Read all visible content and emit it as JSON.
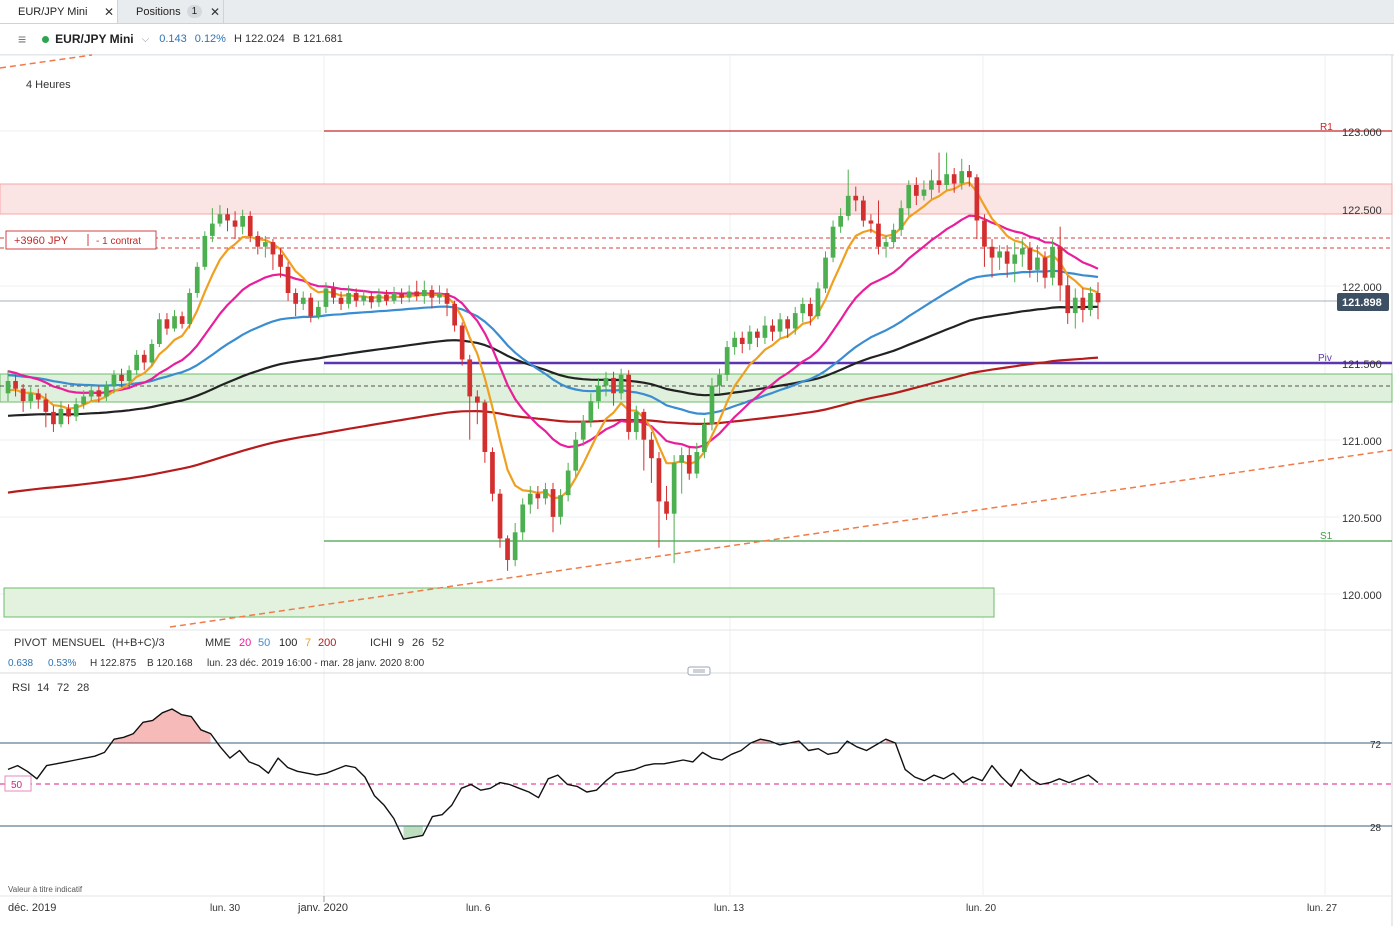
{
  "tabs": [
    {
      "label": "EUR/JPY Mini",
      "close": "✕"
    },
    {
      "label": "Positions",
      "badge": "1",
      "close": "✕"
    }
  ],
  "instrument": {
    "menu_icon": "hamburger-icon",
    "status_color": "#2ea44f",
    "name": "EUR/JPY Mini",
    "change": "0.143",
    "change_pct": "0.12%",
    "high": "H 122.024",
    "low": "B 121.681"
  },
  "timeframe": "4 Heures",
  "position_tag": {
    "pnl": "+3960 JPY",
    "size": "- 1 contrat"
  },
  "price_axis": {
    "ticks": [
      "123.000",
      "122.500",
      "122.000",
      "121.500",
      "121.000",
      "120.500",
      "120.000"
    ],
    "current_price": "121.898"
  },
  "levels": {
    "r1": "R1",
    "piv": "Piv",
    "s1": "S1"
  },
  "indicator_legend": {
    "pivot_name": "PIVOT",
    "pivot_period": "MENSUEL",
    "pivot_formula": "(H+B+C)/3",
    "mme_name": "MME",
    "mme_periods": [
      "20",
      "50",
      "100",
      "7",
      "200"
    ],
    "ichi_name": "ICHI",
    "ichi_params": [
      "9",
      "26",
      "52"
    ],
    "stats": {
      "change": "0.638",
      "change_pct": "0.53%",
      "high": "H 122.875",
      "low": "B 120.168",
      "range": "lun. 23 déc. 2019 16:00 - mar. 28 janv. 2020 8:00"
    }
  },
  "rsi": {
    "label": "RSI",
    "params": [
      "14",
      "72",
      "28"
    ],
    "levels": [
      "72",
      "50",
      "28"
    ]
  },
  "disclaimer": "Valeur à titre indicatif",
  "time_axis": [
    "déc. 2019",
    "lun. 30",
    "janv. 2020",
    "lun. 6",
    "lun. 13",
    "lun. 20",
    "lun. 27"
  ],
  "colors": {
    "up": "#4caf50",
    "down": "#d32f2f",
    "ema20": "#e91e9c",
    "ema50": "#3a8dd1",
    "ema100": "#222222",
    "ema7": "#f0a020",
    "ema200": "#b71c1c",
    "pivot": "#5e35b1",
    "trendline": "#f07b47",
    "rsi_line": "#111111"
  },
  "chart_data": {
    "type": "candlestick",
    "price_range": [
      119.8,
      123.4
    ],
    "rsi_range": [
      0,
      100
    ],
    "pivot_levels": {
      "R1": 123.0,
      "Piv": 121.5,
      "S1": 120.34
    },
    "candles": [
      {
        "o": 121.3,
        "c": 121.38,
        "h": 121.45,
        "l": 121.25
      },
      {
        "o": 121.38,
        "c": 121.33,
        "h": 121.42,
        "l": 121.28
      },
      {
        "o": 121.33,
        "c": 121.25,
        "h": 121.36,
        "l": 121.18
      },
      {
        "o": 121.25,
        "c": 121.3,
        "h": 121.34,
        "l": 121.2
      },
      {
        "o": 121.3,
        "c": 121.26,
        "h": 121.33,
        "l": 121.2
      },
      {
        "o": 121.26,
        "c": 121.18,
        "h": 121.3,
        "l": 121.08
      },
      {
        "o": 121.18,
        "c": 121.1,
        "h": 121.22,
        "l": 121.05
      },
      {
        "o": 121.1,
        "c": 121.2,
        "h": 121.25,
        "l": 121.08
      },
      {
        "o": 121.2,
        "c": 121.15,
        "h": 121.23,
        "l": 121.1
      },
      {
        "o": 121.15,
        "c": 121.23,
        "h": 121.27,
        "l": 121.12
      },
      {
        "o": 121.23,
        "c": 121.28,
        "h": 121.32,
        "l": 121.2
      },
      {
        "o": 121.28,
        "c": 121.32,
        "h": 121.36,
        "l": 121.25
      },
      {
        "o": 121.32,
        "c": 121.28,
        "h": 121.35,
        "l": 121.24
      },
      {
        "o": 121.28,
        "c": 121.35,
        "h": 121.38,
        "l": 121.25
      },
      {
        "o": 121.35,
        "c": 121.42,
        "h": 121.45,
        "l": 121.3
      },
      {
        "o": 121.42,
        "c": 121.38,
        "h": 121.46,
        "l": 121.34
      },
      {
        "o": 121.38,
        "c": 121.45,
        "h": 121.48,
        "l": 121.35
      },
      {
        "o": 121.45,
        "c": 121.55,
        "h": 121.58,
        "l": 121.42
      },
      {
        "o": 121.55,
        "c": 121.5,
        "h": 121.58,
        "l": 121.45
      },
      {
        "o": 121.5,
        "c": 121.62,
        "h": 121.65,
        "l": 121.48
      },
      {
        "o": 121.62,
        "c": 121.78,
        "h": 121.82,
        "l": 121.6
      },
      {
        "o": 121.78,
        "c": 121.72,
        "h": 121.82,
        "l": 121.68
      },
      {
        "o": 121.72,
        "c": 121.8,
        "h": 121.84,
        "l": 121.7
      },
      {
        "o": 121.8,
        "c": 121.75,
        "h": 121.83,
        "l": 121.72
      },
      {
        "o": 121.75,
        "c": 121.95,
        "h": 121.98,
        "l": 121.72
      },
      {
        "o": 121.95,
        "c": 122.12,
        "h": 122.15,
        "l": 121.92
      },
      {
        "o": 122.12,
        "c": 122.32,
        "h": 122.35,
        "l": 122.1
      },
      {
        "o": 122.32,
        "c": 122.4,
        "h": 122.5,
        "l": 122.28
      },
      {
        "o": 122.4,
        "c": 122.46,
        "h": 122.52,
        "l": 122.38
      },
      {
        "o": 122.46,
        "c": 122.42,
        "h": 122.5,
        "l": 122.35
      },
      {
        "o": 122.42,
        "c": 122.38,
        "h": 122.48,
        "l": 122.3
      },
      {
        "o": 122.38,
        "c": 122.45,
        "h": 122.49,
        "l": 122.33
      },
      {
        "o": 122.45,
        "c": 122.32,
        "h": 122.48,
        "l": 122.28
      },
      {
        "o": 122.32,
        "c": 122.25,
        "h": 122.35,
        "l": 122.2
      },
      {
        "o": 122.25,
        "c": 122.28,
        "h": 122.32,
        "l": 122.18
      },
      {
        "o": 122.28,
        "c": 122.2,
        "h": 122.3,
        "l": 122.1
      },
      {
        "o": 122.2,
        "c": 122.12,
        "h": 122.24,
        "l": 122.05
      },
      {
        "o": 122.12,
        "c": 121.95,
        "h": 122.15,
        "l": 121.9
      },
      {
        "o": 121.95,
        "c": 121.88,
        "h": 121.98,
        "l": 121.8
      },
      {
        "o": 121.88,
        "c": 121.92,
        "h": 121.96,
        "l": 121.84
      },
      {
        "o": 121.92,
        "c": 121.8,
        "h": 121.95,
        "l": 121.76
      },
      {
        "o": 121.8,
        "c": 121.86,
        "h": 121.9,
        "l": 121.78
      },
      {
        "o": 121.86,
        "c": 121.98,
        "h": 122.02,
        "l": 121.82
      },
      {
        "o": 121.98,
        "c": 121.92,
        "h": 122.02,
        "l": 121.88
      },
      {
        "o": 121.92,
        "c": 121.88,
        "h": 121.96,
        "l": 121.84
      },
      {
        "o": 121.88,
        "c": 121.95,
        "h": 122.0,
        "l": 121.85
      },
      {
        "o": 121.95,
        "c": 121.9,
        "h": 121.98,
        "l": 121.86
      },
      {
        "o": 121.9,
        "c": 121.93,
        "h": 121.97,
        "l": 121.87
      },
      {
        "o": 121.93,
        "c": 121.89,
        "h": 121.96,
        "l": 121.85
      },
      {
        "o": 121.89,
        "c": 121.94,
        "h": 121.98,
        "l": 121.86
      },
      {
        "o": 121.94,
        "c": 121.9,
        "h": 121.97,
        "l": 121.87
      },
      {
        "o": 121.9,
        "c": 121.95,
        "h": 121.99,
        "l": 121.88
      },
      {
        "o": 121.95,
        "c": 121.92,
        "h": 121.98,
        "l": 121.88
      },
      {
        "o": 121.92,
        "c": 121.96,
        "h": 122.0,
        "l": 121.89
      },
      {
        "o": 121.96,
        "c": 121.93,
        "h": 122.03,
        "l": 121.9
      },
      {
        "o": 121.93,
        "c": 121.97,
        "h": 122.03,
        "l": 121.88
      },
      {
        "o": 121.97,
        "c": 121.92,
        "h": 122.0,
        "l": 121.85
      },
      {
        "o": 121.92,
        "c": 121.95,
        "h": 122.0,
        "l": 121.88
      },
      {
        "o": 121.95,
        "c": 121.88,
        "h": 121.98,
        "l": 121.8
      },
      {
        "o": 121.88,
        "c": 121.74,
        "h": 121.9,
        "l": 121.7
      },
      {
        "o": 121.74,
        "c": 121.52,
        "h": 121.76,
        "l": 121.48
      },
      {
        "o": 121.52,
        "c": 121.28,
        "h": 121.55,
        "l": 121.0
      },
      {
        "o": 121.28,
        "c": 121.24,
        "h": 121.32,
        "l": 121.1
      },
      {
        "o": 121.24,
        "c": 120.92,
        "h": 121.26,
        "l": 120.85
      },
      {
        "o": 120.92,
        "c": 120.65,
        "h": 120.95,
        "l": 120.6
      },
      {
        "o": 120.65,
        "c": 120.36,
        "h": 120.68,
        "l": 120.3
      },
      {
        "o": 120.36,
        "c": 120.22,
        "h": 120.38,
        "l": 120.15
      },
      {
        "o": 120.22,
        "c": 120.4,
        "h": 120.46,
        "l": 120.18
      },
      {
        "o": 120.4,
        "c": 120.58,
        "h": 120.62,
        "l": 120.35
      },
      {
        "o": 120.58,
        "c": 120.65,
        "h": 120.7,
        "l": 120.52
      },
      {
        "o": 120.65,
        "c": 120.62,
        "h": 120.7,
        "l": 120.55
      },
      {
        "o": 120.62,
        "c": 120.68,
        "h": 120.72,
        "l": 120.58
      },
      {
        "o": 120.68,
        "c": 120.5,
        "h": 120.72,
        "l": 120.4
      },
      {
        "o": 120.5,
        "c": 120.64,
        "h": 120.68,
        "l": 120.45
      },
      {
        "o": 120.64,
        "c": 120.8,
        "h": 120.85,
        "l": 120.6
      },
      {
        "o": 120.8,
        "c": 121.0,
        "h": 121.05,
        "l": 120.76
      },
      {
        "o": 121.0,
        "c": 121.12,
        "h": 121.16,
        "l": 120.96
      },
      {
        "o": 121.12,
        "c": 121.25,
        "h": 121.3,
        "l": 121.08
      },
      {
        "o": 121.25,
        "c": 121.35,
        "h": 121.4,
        "l": 121.2
      },
      {
        "o": 121.35,
        "c": 121.4,
        "h": 121.44,
        "l": 121.28
      },
      {
        "o": 121.4,
        "c": 121.3,
        "h": 121.44,
        "l": 121.22
      },
      {
        "o": 121.3,
        "c": 121.42,
        "h": 121.46,
        "l": 121.26
      },
      {
        "o": 121.42,
        "c": 121.05,
        "h": 121.45,
        "l": 121.0
      },
      {
        "o": 121.05,
        "c": 121.18,
        "h": 121.22,
        "l": 121.0
      },
      {
        "o": 121.18,
        "c": 121.0,
        "h": 121.2,
        "l": 120.8
      },
      {
        "o": 121.0,
        "c": 120.88,
        "h": 121.05,
        "l": 120.72
      },
      {
        "o": 120.88,
        "c": 120.6,
        "h": 120.92,
        "l": 120.3
      },
      {
        "o": 120.6,
        "c": 120.52,
        "h": 120.7,
        "l": 120.48
      },
      {
        "o": 120.52,
        "c": 120.85,
        "h": 120.9,
        "l": 120.2
      },
      {
        "o": 120.85,
        "c": 120.9,
        "h": 120.95,
        "l": 120.65
      },
      {
        "o": 120.9,
        "c": 120.78,
        "h": 120.96,
        "l": 120.74
      },
      {
        "o": 120.78,
        "c": 120.92,
        "h": 120.98,
        "l": 120.75
      },
      {
        "o": 120.92,
        "c": 121.1,
        "h": 121.14,
        "l": 120.88
      },
      {
        "o": 121.1,
        "c": 121.35,
        "h": 121.4,
        "l": 121.06
      },
      {
        "o": 121.35,
        "c": 121.42,
        "h": 121.46,
        "l": 121.3
      },
      {
        "o": 121.42,
        "c": 121.6,
        "h": 121.64,
        "l": 121.38
      },
      {
        "o": 121.6,
        "c": 121.66,
        "h": 121.7,
        "l": 121.55
      },
      {
        "o": 121.66,
        "c": 121.62,
        "h": 121.7,
        "l": 121.56
      },
      {
        "o": 121.62,
        "c": 121.7,
        "h": 121.74,
        "l": 121.58
      },
      {
        "o": 121.7,
        "c": 121.66,
        "h": 121.72,
        "l": 121.6
      },
      {
        "o": 121.66,
        "c": 121.74,
        "h": 121.8,
        "l": 121.62
      },
      {
        "o": 121.74,
        "c": 121.7,
        "h": 121.78,
        "l": 121.64
      },
      {
        "o": 121.7,
        "c": 121.78,
        "h": 121.82,
        "l": 121.66
      },
      {
        "o": 121.78,
        "c": 121.72,
        "h": 121.8,
        "l": 121.66
      },
      {
        "o": 121.72,
        "c": 121.82,
        "h": 121.86,
        "l": 121.68
      },
      {
        "o": 121.82,
        "c": 121.88,
        "h": 121.92,
        "l": 121.76
      },
      {
        "o": 121.88,
        "c": 121.8,
        "h": 121.92,
        "l": 121.74
      },
      {
        "o": 121.8,
        "c": 121.98,
        "h": 122.02,
        "l": 121.78
      },
      {
        "o": 121.98,
        "c": 122.18,
        "h": 122.22,
        "l": 121.95
      },
      {
        "o": 122.18,
        "c": 122.38,
        "h": 122.42,
        "l": 122.15
      },
      {
        "o": 122.38,
        "c": 122.45,
        "h": 122.5,
        "l": 122.34
      },
      {
        "o": 122.45,
        "c": 122.58,
        "h": 122.75,
        "l": 122.42
      },
      {
        "o": 122.58,
        "c": 122.55,
        "h": 122.64,
        "l": 122.48
      },
      {
        "o": 122.55,
        "c": 122.42,
        "h": 122.58,
        "l": 122.38
      },
      {
        "o": 122.42,
        "c": 122.4,
        "h": 122.46,
        "l": 122.34
      },
      {
        "o": 122.4,
        "c": 122.25,
        "h": 122.55,
        "l": 122.2
      },
      {
        "o": 122.25,
        "c": 122.28,
        "h": 122.32,
        "l": 122.18
      },
      {
        "o": 122.28,
        "c": 122.36,
        "h": 122.4,
        "l": 122.24
      },
      {
        "o": 122.36,
        "c": 122.5,
        "h": 122.55,
        "l": 122.32
      },
      {
        "o": 122.5,
        "c": 122.65,
        "h": 122.68,
        "l": 122.45
      },
      {
        "o": 122.65,
        "c": 122.58,
        "h": 122.7,
        "l": 122.52
      },
      {
        "o": 122.58,
        "c": 122.62,
        "h": 122.68,
        "l": 122.55
      },
      {
        "o": 122.62,
        "c": 122.68,
        "h": 122.75,
        "l": 122.56
      },
      {
        "o": 122.68,
        "c": 122.65,
        "h": 122.86,
        "l": 122.6
      },
      {
        "o": 122.65,
        "c": 122.72,
        "h": 122.86,
        "l": 122.62
      },
      {
        "o": 122.72,
        "c": 122.66,
        "h": 122.76,
        "l": 122.6
      },
      {
        "o": 122.66,
        "c": 122.74,
        "h": 122.82,
        "l": 122.62
      },
      {
        "o": 122.74,
        "c": 122.7,
        "h": 122.78,
        "l": 122.64
      },
      {
        "o": 122.7,
        "c": 122.42,
        "h": 122.72,
        "l": 122.3
      },
      {
        "o": 122.42,
        "c": 122.25,
        "h": 122.46,
        "l": 122.12
      },
      {
        "o": 122.25,
        "c": 122.18,
        "h": 122.3,
        "l": 122.05
      },
      {
        "o": 122.18,
        "c": 122.22,
        "h": 122.26,
        "l": 122.1
      },
      {
        "o": 122.22,
        "c": 122.14,
        "h": 122.26,
        "l": 122.05
      },
      {
        "o": 122.14,
        "c": 122.2,
        "h": 122.28,
        "l": 122.02
      },
      {
        "o": 122.2,
        "c": 122.24,
        "h": 122.3,
        "l": 122.12
      },
      {
        "o": 122.24,
        "c": 122.1,
        "h": 122.28,
        "l": 122.05
      },
      {
        "o": 122.1,
        "c": 122.18,
        "h": 122.26,
        "l": 122.02
      },
      {
        "o": 122.18,
        "c": 122.05,
        "h": 122.22,
        "l": 121.98
      },
      {
        "o": 122.05,
        "c": 122.25,
        "h": 122.3,
        "l": 122.0
      },
      {
        "o": 122.25,
        "c": 122.0,
        "h": 122.38,
        "l": 121.9
      },
      {
        "o": 122.0,
        "c": 121.82,
        "h": 122.06,
        "l": 121.75
      },
      {
        "o": 121.82,
        "c": 121.92,
        "h": 121.98,
        "l": 121.72
      },
      {
        "o": 121.92,
        "c": 121.84,
        "h": 121.98,
        "l": 121.76
      },
      {
        "o": 121.84,
        "c": 121.95,
        "h": 121.99,
        "l": 121.8
      },
      {
        "o": 121.95,
        "c": 121.89,
        "h": 122.02,
        "l": 121.78
      }
    ],
    "rsi_values": [
      58,
      60,
      57,
      53,
      60,
      61,
      62,
      63,
      64,
      65,
      67,
      74,
      75,
      77,
      83,
      84,
      88,
      90,
      87,
      86,
      79,
      77,
      70,
      64,
      68,
      62,
      60,
      56,
      64,
      59,
      57,
      56,
      55,
      56,
      58,
      60,
      59,
      54,
      44,
      39,
      32,
      21,
      22,
      23,
      33,
      34,
      39,
      48,
      50,
      47,
      48,
      51,
      50,
      48,
      46,
      43,
      53,
      55,
      50,
      49,
      46,
      47,
      52,
      56,
      57,
      58,
      60,
      61,
      61,
      62,
      63,
      62,
      67,
      64,
      63,
      66,
      68,
      72,
      74,
      73,
      71,
      72,
      73,
      68,
      69,
      66,
      67,
      73,
      70,
      68,
      71,
      74,
      72,
      58,
      54,
      52,
      55,
      53,
      56,
      51,
      54,
      52,
      60,
      54,
      49,
      58,
      53,
      50,
      51,
      53,
      51,
      53,
      55,
      51
    ],
    "ema_series": [
      "MME 20",
      "MME 50",
      "MME 100",
      "MME 7",
      "MME 200"
    ]
  }
}
